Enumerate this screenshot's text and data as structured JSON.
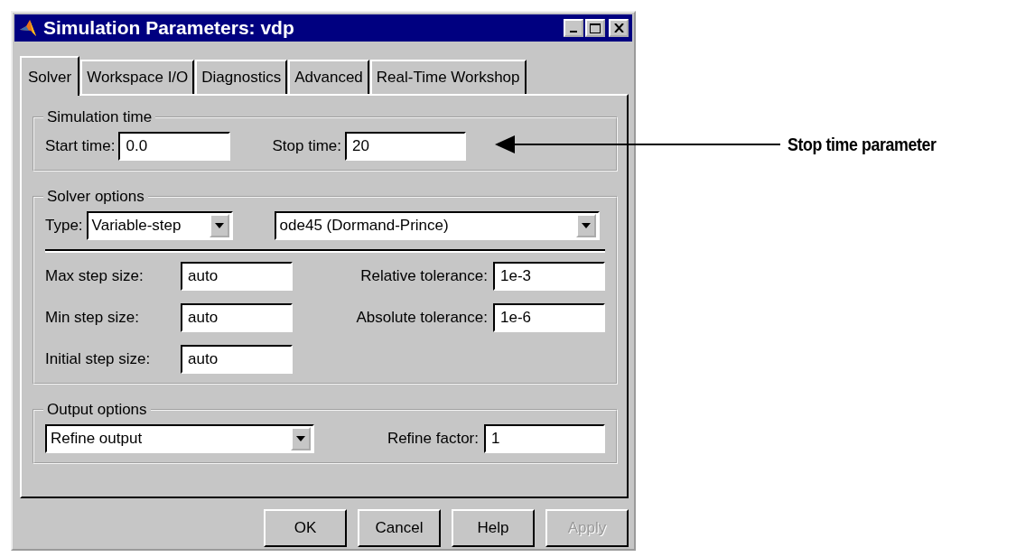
{
  "window": {
    "title": "Simulation Parameters: vdp"
  },
  "tabs": [
    {
      "label": "Solver",
      "selected": true
    },
    {
      "label": "Workspace I/O",
      "selected": false
    },
    {
      "label": "Diagnostics",
      "selected": false
    },
    {
      "label": "Advanced",
      "selected": false
    },
    {
      "label": "Real-Time Workshop",
      "selected": false
    }
  ],
  "simulation_time": {
    "title": "Simulation time",
    "fields": [
      {
        "label": "Start time:",
        "value": "0.0"
      },
      {
        "label": "Stop time:",
        "value": "20"
      }
    ]
  },
  "solver_options": {
    "title": "Solver options",
    "type_label": "Type:",
    "type_value": "Variable-step",
    "solver_value": "ode45 (Dormand-Prince)",
    "left_fields": [
      {
        "label": "Max step size:",
        "value": "auto"
      },
      {
        "label": "Min step size:",
        "value": "auto"
      },
      {
        "label": "Initial step size:",
        "value": "auto"
      }
    ],
    "right_fields": [
      {
        "label": "Relative tolerance:",
        "value": "1e-3"
      },
      {
        "label": "Absolute tolerance:",
        "value": "1e-6"
      }
    ]
  },
  "output_options": {
    "title": "Output options",
    "mode_value": "Refine output",
    "field": {
      "label": "Refine factor:",
      "value": "1"
    }
  },
  "buttons": [
    {
      "label": "OK",
      "disabled": false
    },
    {
      "label": "Cancel",
      "disabled": false
    },
    {
      "label": "Help",
      "disabled": false
    },
    {
      "label": "Apply",
      "disabled": true
    }
  ],
  "annotation": {
    "label": "Stop time parameter"
  }
}
